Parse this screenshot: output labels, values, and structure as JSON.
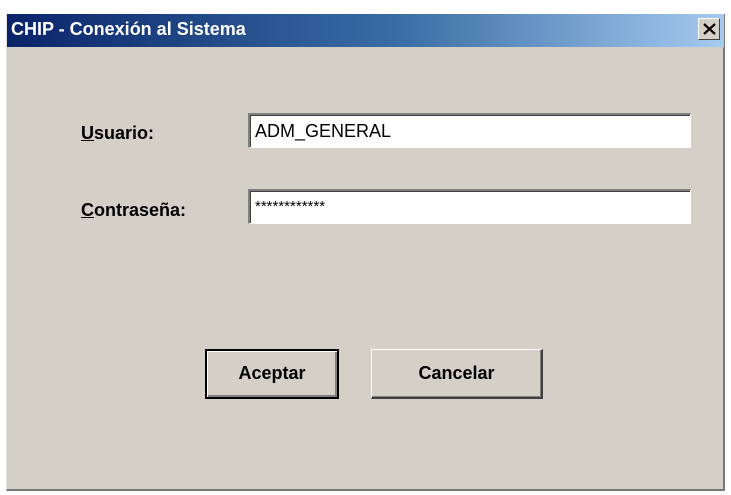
{
  "window": {
    "title": "CHIP - Conexión al Sistema",
    "close_icon": "close-icon"
  },
  "form": {
    "user": {
      "label_mnemonic": "U",
      "label_rest": "suario:",
      "value": "ADM_GENERAL"
    },
    "password": {
      "label_mnemonic": "C",
      "label_rest": "ontraseña:",
      "value": "************"
    }
  },
  "buttons": {
    "accept_label": "Aceptar",
    "cancel_label": "Cancelar"
  },
  "colors": {
    "title_gradient_start": "#0a246a",
    "title_gradient_end": "#a6caf0",
    "dialog_background": "#d4d0c8"
  }
}
